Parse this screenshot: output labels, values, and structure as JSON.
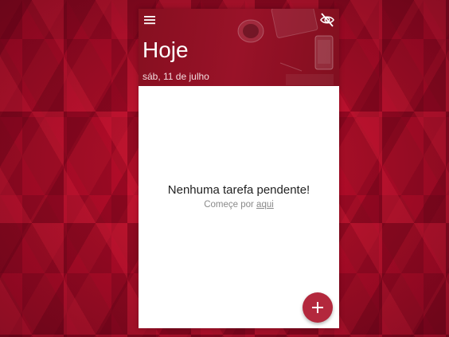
{
  "header": {
    "title": "Hoje",
    "date": "sáb, 11 de julho"
  },
  "empty_state": {
    "title": "Nenhuma tarefa pendente!",
    "subtitle_prefix": "Começe por ",
    "subtitle_link": "aqui"
  },
  "icons": {
    "menu": "menu-icon",
    "visibility": "eye-off-icon",
    "add": "plus-icon"
  },
  "colors": {
    "header": "#9b1328",
    "fab": "#b3283d",
    "background": "#b0102a"
  }
}
